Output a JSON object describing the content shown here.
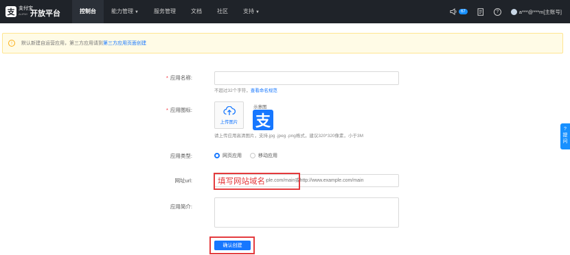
{
  "header": {
    "logo_glyph": "支",
    "logo_text": "支付宝",
    "logo_sub": "ALIPAY",
    "platform": "开放平台",
    "nav": [
      {
        "label": "控制台",
        "active": true
      },
      {
        "label": "能力管理",
        "dropdown": true
      },
      {
        "label": "服务管理"
      },
      {
        "label": "文档"
      },
      {
        "label": "社区"
      },
      {
        "label": "支持",
        "dropdown": true
      }
    ],
    "message_count": "67",
    "user": "a***@***m[主账号]",
    "icons": [
      "speaker-icon",
      "doc-icon",
      "help-icon",
      "user-avatar"
    ]
  },
  "notice": {
    "text": "默认新建自运营应用，第三方应用请到",
    "link": "第三方应用页面创建"
  },
  "form": {
    "app_name_label": "应用名称:",
    "app_name_placeholder": "",
    "app_name_hint": "不超过32个字符，",
    "app_name_hint_link": "查看命名规范",
    "app_icon_label": "应用图标:",
    "upload_label": "上传图片",
    "preview_label": "示意图",
    "preview_glyph": "支",
    "icon_hint": "请上传应用高清图片，支持.jpg .jpeg .png格式，建议320*320像素，小于3M",
    "app_type_label": "应用类型:",
    "app_type_options": [
      {
        "label": "网页应用",
        "checked": true
      },
      {
        "label": "移动应用",
        "checked": false
      }
    ],
    "url_label": "网址url:",
    "url_placeholder": "例：https://www.example.com/main或http://www.example.com/main",
    "desc_label": "应用简介:",
    "submit_label": "确认创建",
    "annotation": "填写网站域名"
  },
  "side_widget": {
    "text": "?\n提\n问"
  }
}
